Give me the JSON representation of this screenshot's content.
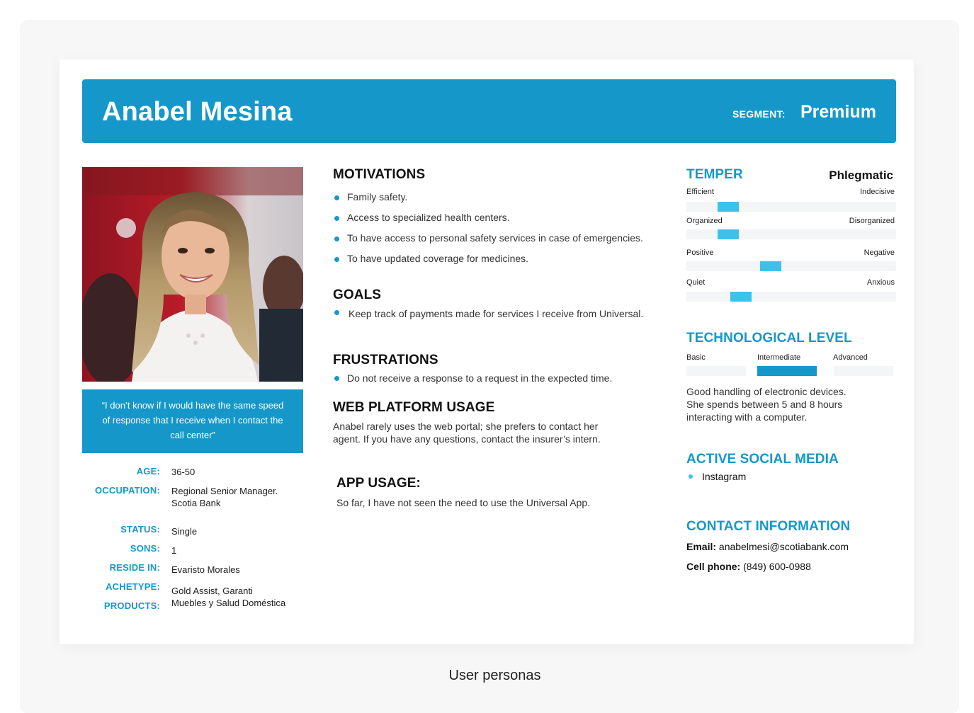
{
  "persona": {
    "name": "Anabel Mesina",
    "segment_label": "SEGMENT:",
    "segment_value": "Premium",
    "quote": "“I don’t know if I would have the same speed of response that I receive when I contact the call center”"
  },
  "colors": {
    "accent": "#1598c9",
    "marker": "#3bc2ea",
    "track": "#f3f5f6"
  },
  "details": {
    "age_label": "AGE:",
    "age": "36-50",
    "occupation_label": "OCCUPATION:",
    "occupation_1": "Regional Senior Manager.",
    "occupation_2": "Scotia Bank",
    "status_label": "STATUS:",
    "status": "Single",
    "sons_label": "SONS:",
    "sons": "1",
    "reside_label": "RESIDE IN:",
    "reside": "Evaristo Morales",
    "achetype_label": "ACHETYPE:",
    "products_label": "PRODUCTS:",
    "products_1": "Gold Assist, Garanti",
    "products_2": "Muebles y Salud Doméstica"
  },
  "motivations": {
    "title": "MOTIVATIONS",
    "items": [
      "Family safety.",
      "Access to specialized health centers.",
      "To have access to personal safety services in case of emergencies.",
      "To have updated coverage for medicines."
    ]
  },
  "goals": {
    "title": "GOALS",
    "items": [
      "Keep track of payments made for services I receive from Universal."
    ]
  },
  "frustrations": {
    "title": "FRUSTRATIONS",
    "items": [
      "Do not receive a response to a request in the expected time."
    ]
  },
  "web_usage": {
    "title": "WEB PLATFORM USAGE",
    "line_1": "Anabel rarely uses the web portal; she prefers to contact her",
    "line_2": "agent. If you have any questions, contact the insurer’s intern."
  },
  "app_usage": {
    "title": "APP USAGE:",
    "text": "So far, I have not seen the need to use the Universal App."
  },
  "temper": {
    "title": "TEMPER",
    "value": "Phlegmatic",
    "scales": [
      {
        "left": "Efficient",
        "right": "Indecisive",
        "level": 0.15
      },
      {
        "left": "Organized",
        "right": "Disorganized",
        "level": 0.15
      },
      {
        "left": "Positive",
        "right": "Negative",
        "level": 0.35
      },
      {
        "left": "Quiet",
        "right": "Anxious",
        "level": 0.21
      }
    ]
  },
  "tech": {
    "title": "TECHNOLOGICAL LEVEL",
    "levels": [
      "Basic",
      "Intermediate",
      "Advanced"
    ],
    "selected": "Intermediate",
    "line_1": "Good handling of electronic devices.",
    "line_2": "She spends between 5 and 8 hours",
    "line_3": "interacting with a computer."
  },
  "social": {
    "title": "ACTIVE SOCIAL MEDIA",
    "items": [
      "Instagram"
    ]
  },
  "contact": {
    "title": "CONTACT INFORMATION",
    "email_label": "Email:",
    "email": "anabelmesi@scotiabank.com",
    "phone_label": "Cell phone:",
    "phone": "(849) 600-0988"
  },
  "caption": "User personas"
}
